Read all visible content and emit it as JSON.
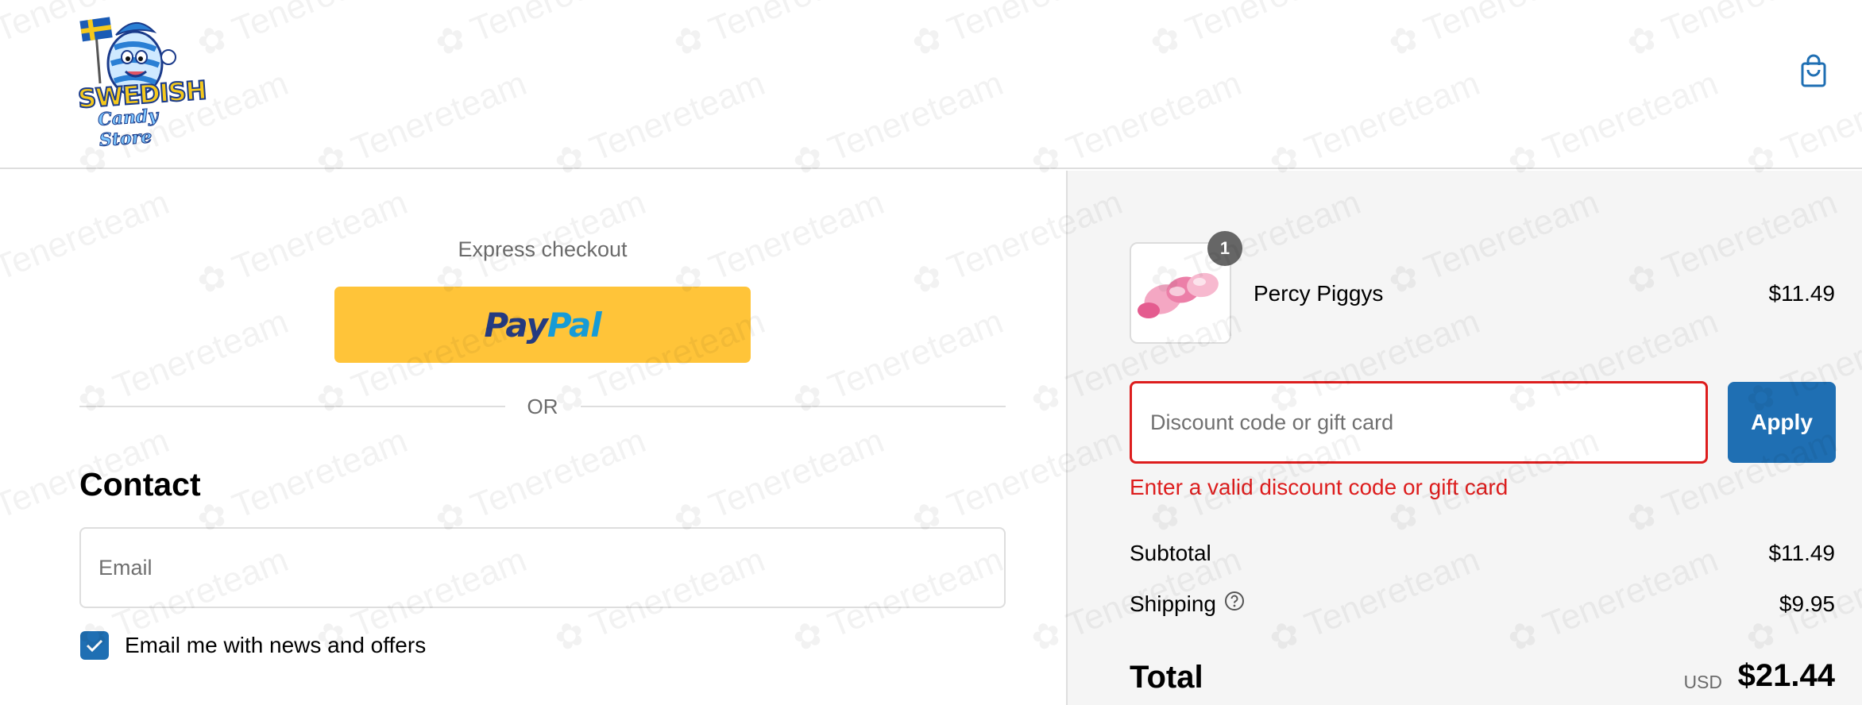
{
  "header": {
    "logo_line1": "SWEDISH",
    "logo_line2": "Candy Store",
    "cart_icon": "shopping-bag-icon"
  },
  "express": {
    "title": "Express checkout",
    "paypal_part1": "Pay",
    "paypal_part2": "Pal",
    "separator": "OR"
  },
  "contact": {
    "heading": "Contact",
    "email_placeholder": "Email",
    "newsletter_label": "Email me with news and offers",
    "newsletter_checked": true
  },
  "order": {
    "item": {
      "quantity": "1",
      "name": "Percy Piggys",
      "price": "$11.49"
    },
    "discount": {
      "placeholder": "Discount code or gift card",
      "apply_label": "Apply",
      "error": "Enter a valid discount code or gift card"
    },
    "subtotal_label": "Subtotal",
    "subtotal_value": "$11.49",
    "shipping_label": "Shipping",
    "shipping_value": "$9.95",
    "total_label": "Total",
    "total_currency": "USD",
    "total_value": "$21.44"
  },
  "colors": {
    "accent": "#1f6fb3",
    "error": "#dd1d1d",
    "paypal_yellow": "#ffc439",
    "sidebar_bg": "#f5f5f5"
  }
}
